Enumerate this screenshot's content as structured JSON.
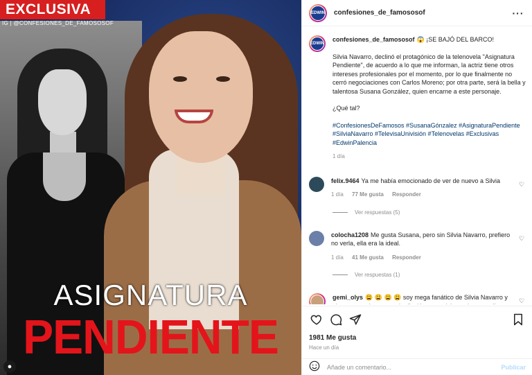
{
  "post_image": {
    "badge": "EXCLUSIVA",
    "source": "IG | @CONFESIONES_DE_FAMOSOSOF",
    "title_line1": "ASIGNATURA",
    "title_line2": "PENDIENTE"
  },
  "header": {
    "avatar_text": "EDWIN",
    "username": "confesiones_de_famososof"
  },
  "caption": {
    "username": "confesiones_de_famososof",
    "headline": "😱 ¡SE BAJÓ DEL BARCO!",
    "body": "Silvia Navarro, declinó el protagónico de la telenovela \"Asignatura Pendiente\", de acuerdo a lo que me informan, la actriz tiene otros intereses profesionales por el momento, por lo que finalmente no cerró negociaciones con Carlos Moreno; por otra parte, será la bella y talentosa Susana González, quien encarne a este personaje.",
    "question": "¿Qué tal?",
    "hashtags": "#ConfesionesDeFamosos #SusanaGónzalez #AsignaturaPendiente #SilviaNavarro #TelevisaUnivisión #Telenovelas #Exclusivas #EdwinPalencia",
    "time": "1 día"
  },
  "comments": [
    {
      "username": "felix.9464",
      "text": "Ya me había emocionado de ver de nuevo a Silvia",
      "time": "1 día",
      "likes": "77 Me gusta",
      "reply": "Responder",
      "view_replies": "Ver respuestas (5)"
    },
    {
      "username": "colocha1208",
      "text": "Me gusta Susana, pero sin Silvia Navarro, prefiero no verla, ella era la ideal.",
      "time": "1 día",
      "likes": "41 Me gusta",
      "reply": "Responder",
      "view_replies": "Ver respuestas (1)"
    },
    {
      "username": "gemi_olys",
      "text": "😩 😩 😩 😩 soy mega fanático de Silvia Navarro y claro que teníamos mucha ilusión que volviera a las pantallas con una telenovela pero por algo no lo hace, de todas maneras admiro muchísimo el trabajo de Susana González yo creo que"
    }
  ],
  "actions": {
    "likes": "1981 Me gusta",
    "time": "Hace un día"
  },
  "add_comment": {
    "placeholder": "Añade un comentario...",
    "publish": "Publicar"
  },
  "colors": {
    "badge_red": "#d71f1f",
    "title_red": "#e4141b",
    "hashtag_blue": "#00376b",
    "publish_disabled": "#b3dbff"
  }
}
